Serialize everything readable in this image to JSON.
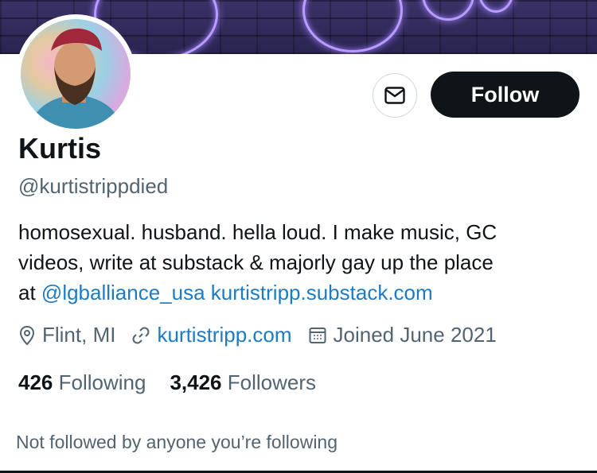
{
  "profile": {
    "name": "Kurtis",
    "handle": "@kurtistrippdied",
    "bio": {
      "line1": "homosexual. husband. hella loud. I make music, GC",
      "line2": "videos, write at substack & majorly gay up the place",
      "line3_prefix": "at ",
      "mention": "@lgballiance_usa",
      "url": "kurtistripp.substack.com"
    },
    "location": "Flint, MI",
    "website": "kurtistripp.com",
    "joined": "Joined June 2021",
    "following_count": "426",
    "following_label": "Following",
    "followers_count": "3,426",
    "followers_label": "Followers",
    "followed_by_note": "Not followed by anyone you’re following"
  },
  "actions": {
    "follow_label": "Follow",
    "message_icon": "mail-icon"
  },
  "colors": {
    "link": "#1d7bc6",
    "secondary_text": "#536471",
    "follow_bg": "#0f1419"
  }
}
